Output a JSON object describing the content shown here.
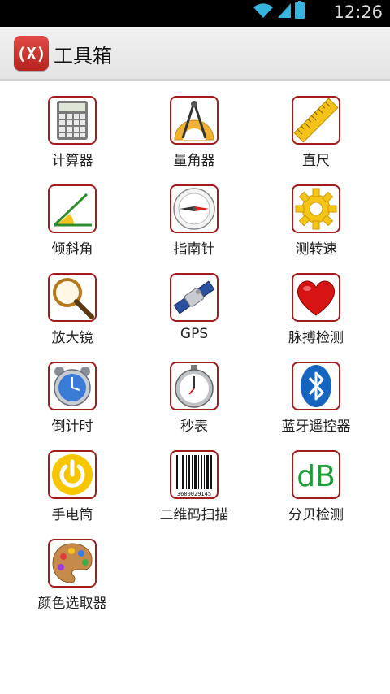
{
  "status_bar": {
    "time": "12:26",
    "icons": [
      "wifi-icon",
      "signal-icon",
      "battery-icon"
    ]
  },
  "action_bar": {
    "logo_text": "(X)",
    "title": "工具箱"
  },
  "colors": {
    "tile_border": "#a41b1b",
    "logo": "#c9302c",
    "dB": "#1f9d3a"
  },
  "tools": [
    {
      "label": "计算器",
      "icon": "calculator-icon"
    },
    {
      "label": "量角器",
      "icon": "protractor-icon"
    },
    {
      "label": "直尺",
      "icon": "ruler-icon"
    },
    {
      "label": "倾斜角",
      "icon": "tilt-angle-icon"
    },
    {
      "label": "指南针",
      "icon": "compass-icon"
    },
    {
      "label": "测转速",
      "icon": "gear-icon"
    },
    {
      "label": "放大镜",
      "icon": "magnifier-icon"
    },
    {
      "label": "GPS",
      "icon": "satellite-icon"
    },
    {
      "label": "脉搏检测",
      "icon": "heart-icon"
    },
    {
      "label": "倒计时",
      "icon": "alarm-clock-icon"
    },
    {
      "label": "秒表",
      "icon": "stopwatch-icon"
    },
    {
      "label": "蓝牙遥控器",
      "icon": "bluetooth-icon"
    },
    {
      "label": "手电筒",
      "icon": "power-icon"
    },
    {
      "label": "二维码扫描",
      "icon": "barcode-icon",
      "barcode_text": "3600029145"
    },
    {
      "label": "分贝检测",
      "icon": "decibel-icon",
      "icon_text": "dB"
    },
    {
      "label": "颜色选取器",
      "icon": "palette-icon"
    }
  ]
}
